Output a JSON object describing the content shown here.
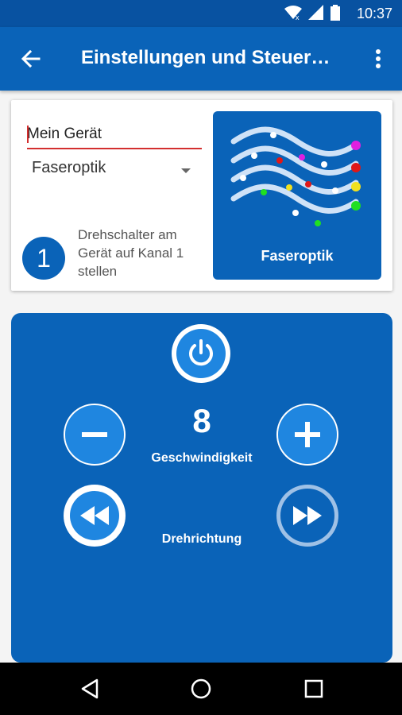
{
  "status_bar": {
    "time": "10:37",
    "icons": [
      "wifi-icon",
      "signal-icon",
      "battery-icon"
    ]
  },
  "app_bar": {
    "title": "Einstellungen und Steuer…",
    "back_icon": "arrow-back-icon",
    "menu_icon": "more-vert-icon"
  },
  "device": {
    "name_value": "Mein Gerät",
    "type_selected": "Faseroptik",
    "channel_number": "1",
    "channel_text": "Drehschalter am Gerät auf Kanal 1 stellen",
    "tile_label": "Faseroptik"
  },
  "controls": {
    "power_icon": "power-icon",
    "speed_value": "8",
    "speed_label": "Geschwindigkeit",
    "direction_label": "Drehrichtung"
  },
  "colors": {
    "primary": "#0a63b8",
    "status_bar": "#0852a1",
    "accent_light": "#1f86e0",
    "error_underline": "#d32f2f"
  },
  "nav_bar": {
    "icons": [
      "back-triangle-icon",
      "home-circle-icon",
      "recents-square-icon"
    ]
  }
}
